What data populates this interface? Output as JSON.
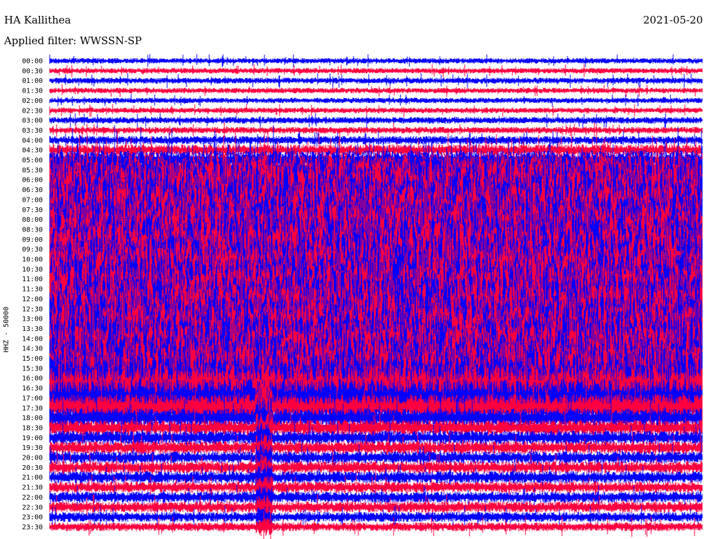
{
  "header": {
    "station": "HA Kallithea",
    "date": "2021-05-20",
    "filter": "Applied filter: WWSSN-SP"
  },
  "chart_data": {
    "type": "line",
    "title": "HA Kallithea",
    "date": "2021-05-20",
    "filter": "WWSSN-SP",
    "ylabel": "HHZ - 50000",
    "xlabel": "",
    "row_labels": [
      "00:00",
      "00:30",
      "01:00",
      "01:30",
      "02:00",
      "02:30",
      "03:00",
      "03:30",
      "04:00",
      "04:30",
      "05:00",
      "05:30",
      "06:00",
      "06:30",
      "07:00",
      "07:30",
      "08:00",
      "08:30",
      "09:00",
      "09:30",
      "10:00",
      "10:30",
      "11:00",
      "11:30",
      "12:00",
      "12:30",
      "13:00",
      "13:30",
      "14:00",
      "14:30",
      "15:00",
      "15:30",
      "16:00",
      "16:30",
      "17:00",
      "17:30",
      "18:00",
      "18:30",
      "19:00",
      "19:30",
      "20:00",
      "20:30",
      "21:00",
      "21:30",
      "22:00",
      "22:30",
      "23:00",
      "23:30"
    ],
    "row_minutes": 30,
    "trace_colors": [
      "#0000ff",
      "#ff0040"
    ],
    "relative_amplitude": [
      1.0,
      1.0,
      1.1,
      1.0,
      1.0,
      1.0,
      1.2,
      1.2,
      1.5,
      2.0,
      3.5,
      6.0,
      9.0,
      10.0,
      10.0,
      10.0,
      10.0,
      10.0,
      10.0,
      10.0,
      10.0,
      10.0,
      10.0,
      10.0,
      10.0,
      10.0,
      10.0,
      10.0,
      10.0,
      10.0,
      10.0,
      10.0,
      10.0,
      9.0,
      7.0,
      5.0,
      3.5,
      2.8,
      2.5,
      2.3,
      2.2,
      2.2,
      2.2,
      2.0,
      2.0,
      2.0,
      1.8,
      1.6
    ],
    "grid": false,
    "legend": "none"
  }
}
